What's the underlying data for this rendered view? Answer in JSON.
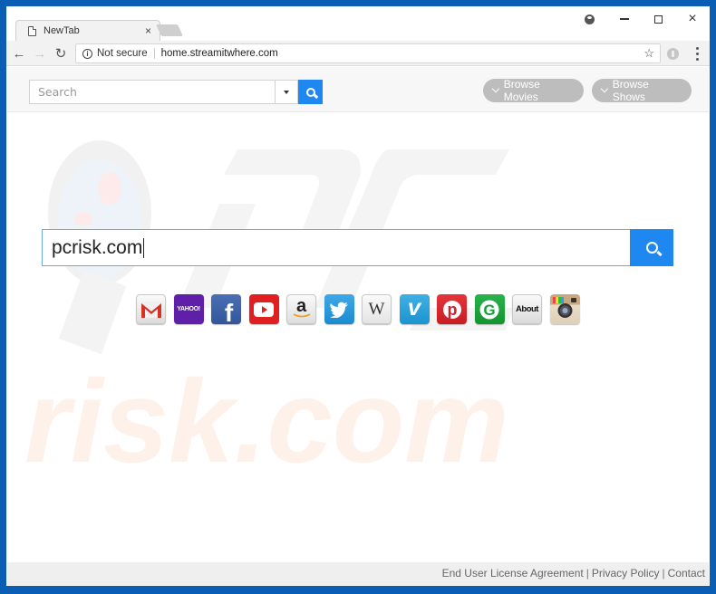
{
  "browser": {
    "tab_title": "NewTab",
    "tab_close": "×",
    "security_label": "Not secure",
    "url": "home.streamitwhere.com",
    "window_controls": {
      "minimize": "minimize",
      "maximize": "maximize",
      "close": "×"
    }
  },
  "header": {
    "search_placeholder": "Search",
    "browse_movies": "Browse Movies",
    "browse_shows": "Browse Shows",
    "accent_color": "#1e88f0"
  },
  "main": {
    "search_value": "pcrisk.com",
    "quick_links": [
      {
        "name": "gmail",
        "label": "M"
      },
      {
        "name": "yahoo",
        "label": "YAHOO!"
      },
      {
        "name": "facebook",
        "label": "f"
      },
      {
        "name": "youtube",
        "label": "▶"
      },
      {
        "name": "amazon",
        "label": "a"
      },
      {
        "name": "twitter",
        "label": "🐦"
      },
      {
        "name": "wikipedia",
        "label": "W"
      },
      {
        "name": "vimeo",
        "label": "v"
      },
      {
        "name": "pinterest",
        "label": "p"
      },
      {
        "name": "grammarly",
        "label": "G"
      },
      {
        "name": "about",
        "label": "About"
      },
      {
        "name": "instagram",
        "label": ""
      }
    ]
  },
  "footer": {
    "links": [
      "End User License Agreement",
      "Privacy Policy",
      "Contact"
    ],
    "separator": "|"
  },
  "watermark": {
    "text": "risk.com"
  }
}
